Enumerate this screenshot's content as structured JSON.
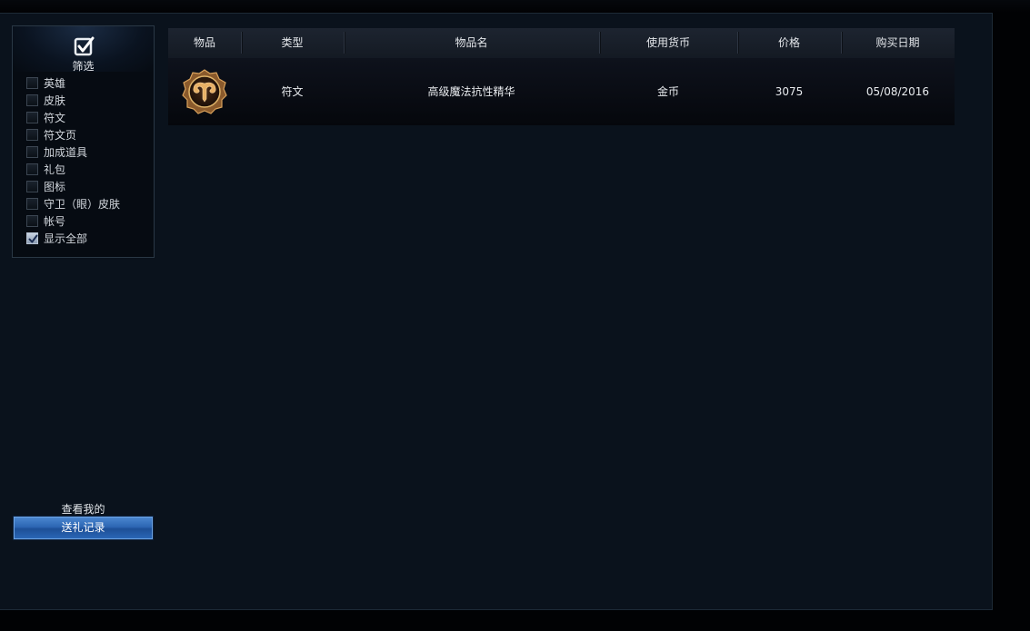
{
  "filter": {
    "title": "筛选",
    "items": [
      {
        "label": "英雄",
        "checked": false
      },
      {
        "label": "皮肤",
        "checked": false
      },
      {
        "label": "符文",
        "checked": false
      },
      {
        "label": "符文页",
        "checked": false
      },
      {
        "label": "加成道具",
        "checked": false
      },
      {
        "label": "礼包",
        "checked": false
      },
      {
        "label": "图标",
        "checked": false
      },
      {
        "label": "守卫（眼）皮肤",
        "checked": false
      },
      {
        "label": "帐号",
        "checked": false
      },
      {
        "label": "显示全部",
        "checked": true
      }
    ]
  },
  "gift": {
    "caption": "查看我的",
    "button_label": "送礼记录"
  },
  "table": {
    "headers": [
      "物品",
      "类型",
      "物品名",
      "使用货币",
      "价格",
      "购买日期"
    ],
    "rows": [
      {
        "icon": "rune-ram-icon",
        "type": "符文",
        "name": "高级魔法抗性精华",
        "currency": "金币",
        "price": "3075",
        "date": "05/08/2016"
      }
    ]
  },
  "colors": {
    "background": "#0a121c",
    "accent_button": "#2c66b3",
    "rune_gold": "#c48a4a"
  }
}
